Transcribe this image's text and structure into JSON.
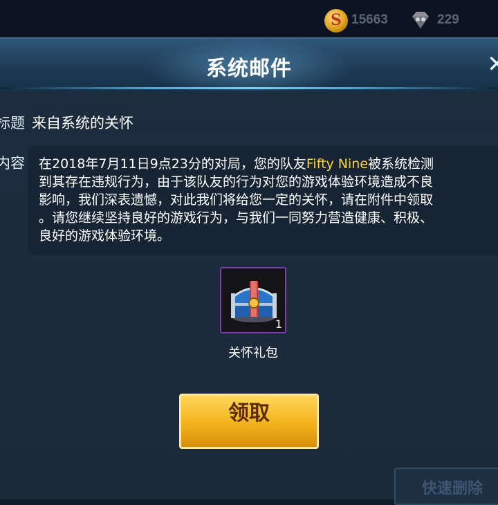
{
  "currency": {
    "gold": {
      "icon": "gold-coin-icon",
      "symbol": "S",
      "value": "15663"
    },
    "gems": {
      "icon": "diamond-icon",
      "value": "229"
    }
  },
  "dialog": {
    "title": "系统邮件",
    "close_icon": "close-icon",
    "subject_label": "标题",
    "subject_value": "来自系统的关怀",
    "content_label": "内容",
    "content": {
      "line1_prefix": "在2018年7月11日9点23分的对局，您的队友",
      "player_name": "Fifty  Nine",
      "line1_suffix": "被系统检测",
      "line2": "到其存在违规行为，由于该队友的行为对您的游戏体验环境造成不良",
      "line3": "影响，我们深表遗憾，对此我们将给您一定的关怀，请在附件中领取",
      "line4": "。请您继续坚持良好的游戏行为，与我们一同努力营造健康、积极、",
      "line5": "良好的游戏体验环境。"
    },
    "attachment": {
      "icon": "treasure-chest-icon",
      "count": "1",
      "name": "关怀礼包"
    },
    "claim_button": "领取"
  },
  "background": {
    "quick_delete_label": "快速删除"
  },
  "colors": {
    "highlight": "#ffd23a",
    "button": "#f2b21c",
    "item_border": "#7a3ea8"
  }
}
